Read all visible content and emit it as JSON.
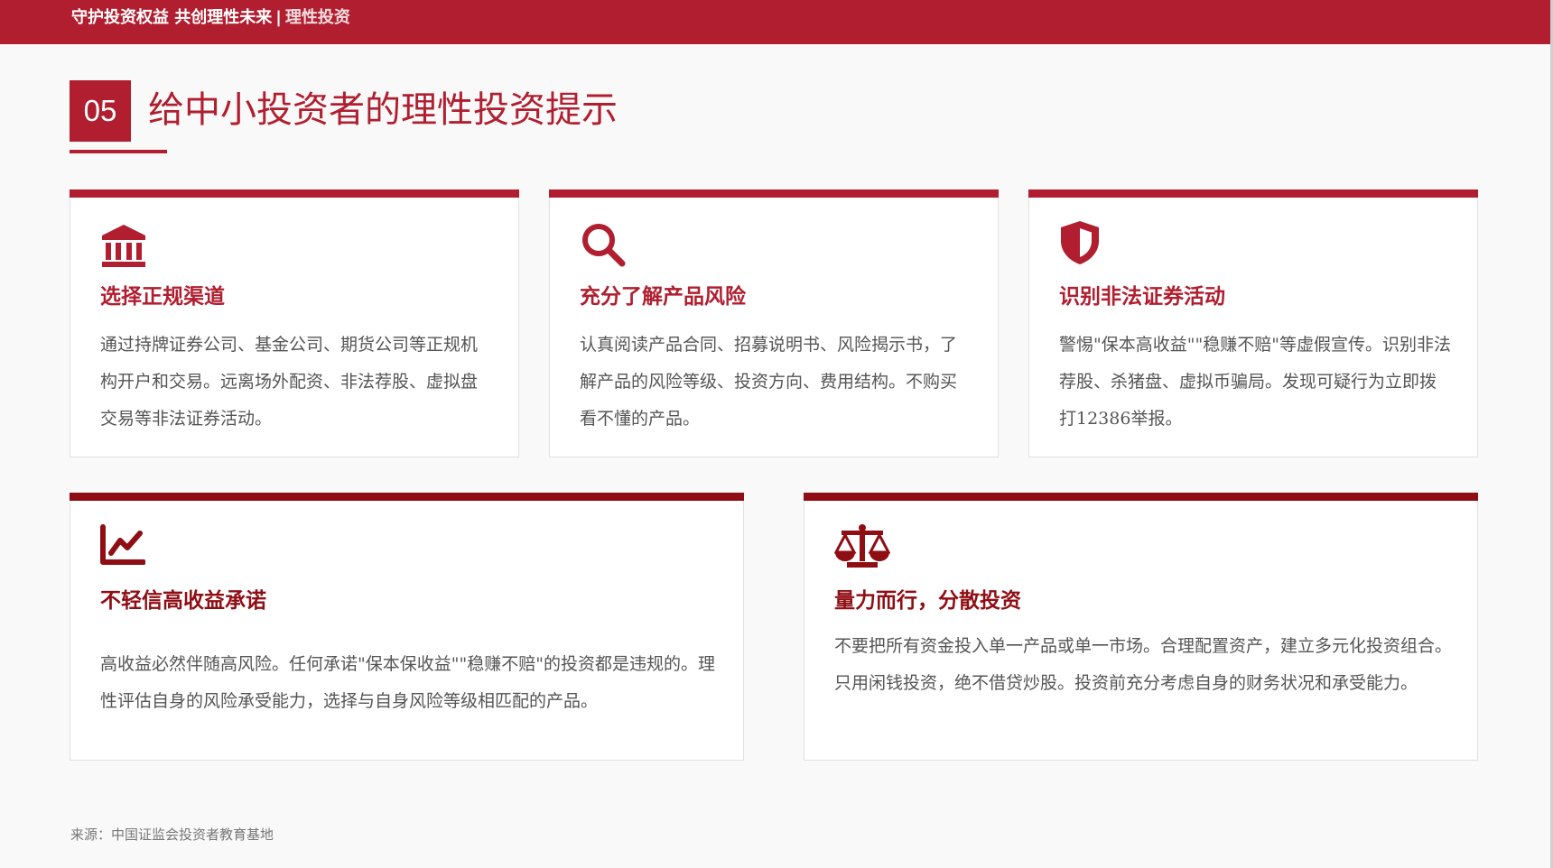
{
  "header": {
    "brand": "守护投资权益 共创理性未来",
    "separator": "|",
    "subtitle": "理性投资"
  },
  "section": {
    "number": "05",
    "title": "给中小投资者的理性投资提示"
  },
  "cards": [
    {
      "icon": "bank-icon",
      "title": "选择正规渠道",
      "text": "通过持牌证券公司、基金公司、期货公司等正规机构开户和交易。远离场外配资、非法荐股、虚拟盘交易等非法证券活动。"
    },
    {
      "icon": "search-icon",
      "title": "充分了解产品风险",
      "text": "认真阅读产品合同、招募说明书、风险揭示书，了解产品的风险等级、投资方向、费用结构。不购买看不懂的产品。"
    },
    {
      "icon": "shield-icon",
      "title": "识别非法证券活动",
      "text": "警惕\"保本高收益\"\"稳赚不赔\"等虚假宣传。识别非法荐股、杀猪盘、虚拟币骗局。发现可疑行为立即拨打12386举报。"
    },
    {
      "icon": "chart-line-icon",
      "title": "不轻信高收益承诺",
      "text": "高收益必然伴随高风险。任何承诺\"保本保收益\"\"稳赚不赔\"的投资都是违规的。理性评估自身的风险承受能力，选择与自身风险等级相匹配的产品。"
    },
    {
      "icon": "balance-scale-icon",
      "title": "量力而行，分散投资",
      "text": "不要把所有资金投入单一产品或单一市场。合理配置资产，建立多元化投资组合。只用闲钱投资，绝不借贷炒股。投资前充分考虑自身的财务状况和承受能力。"
    }
  ],
  "footer": {
    "source": "来源：中国证监会投资者教育基地"
  },
  "colors": {
    "primary": "#b01e2f",
    "dark_red": "#8e0e14",
    "background": "#f9f9f9"
  }
}
